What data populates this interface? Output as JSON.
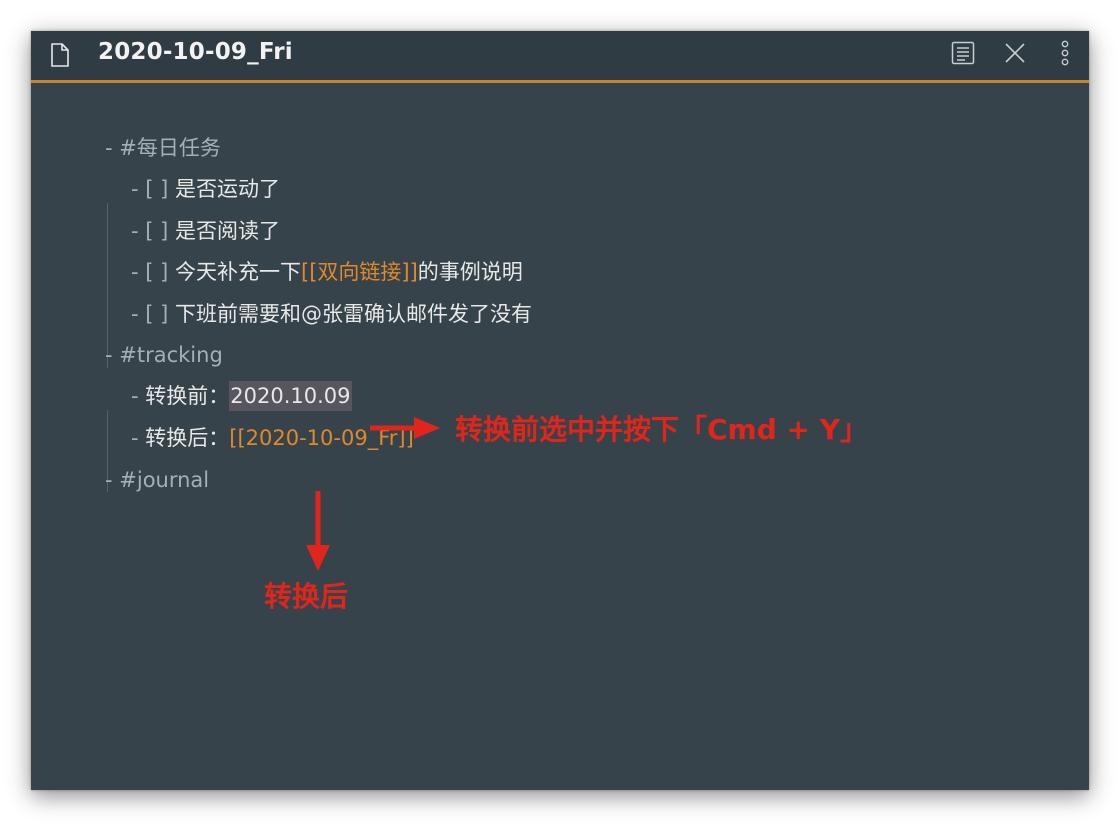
{
  "window": {
    "title": "2020-10-09_Fri",
    "icons": [
      "file-icon",
      "reading-view-icon",
      "close-icon",
      "more-options-icon"
    ]
  },
  "colors": {
    "background": "#36434a",
    "accent_line": "#c4852c",
    "link": "#e0892a",
    "annotation": "#e0251b"
  },
  "doc": {
    "l1": {
      "bullet": "-",
      "tag": "#每日任务"
    },
    "l2": {
      "prefix": "- [ ]",
      "text": "是否运动了"
    },
    "l3": {
      "prefix": "- [ ]",
      "text": "是否阅读了"
    },
    "l4": {
      "prefix": "- [ ]",
      "pre": "今天补充一下",
      "link": "[[双向链接]]",
      "post": "的事例说明"
    },
    "l5": {
      "prefix": "- [ ]",
      "text": "下班前需要和@张雷确认邮件发了没有"
    },
    "l6": {
      "bullet": "-",
      "tag": "#tracking"
    },
    "l7": {
      "bullet": "-",
      "label": "转换前：",
      "selected": "2020.10.09"
    },
    "l8": {
      "bullet": "-",
      "label": "转换后：",
      "link": "[[2020-10-09_Fr]]"
    },
    "l9": {
      "bullet": "-",
      "tag": "#journal"
    }
  },
  "annotations": {
    "right": "转换前选中并按下「Cmd + Y」",
    "down": "转换后"
  }
}
